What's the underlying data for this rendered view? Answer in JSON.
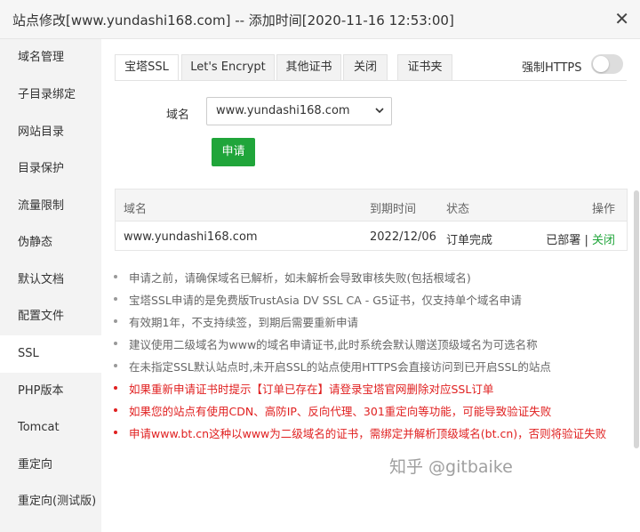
{
  "window": {
    "title": "站点修改[www.yundashi168.com] -- 添加时间[2020-11-16 12:53:00]",
    "close_icon": "close-icon"
  },
  "sidebar": {
    "items": [
      {
        "label": "域名管理"
      },
      {
        "label": "子目录绑定"
      },
      {
        "label": "网站目录"
      },
      {
        "label": "目录保护"
      },
      {
        "label": "流量限制"
      },
      {
        "label": "伪静态"
      },
      {
        "label": "默认文档"
      },
      {
        "label": "配置文件"
      },
      {
        "label": "SSL",
        "active": true
      },
      {
        "label": "PHP版本"
      },
      {
        "label": "Tomcat"
      },
      {
        "label": "重定向"
      },
      {
        "label": "重定向(测试版)"
      }
    ]
  },
  "tabs": [
    {
      "label": "宝塔SSL",
      "active": true
    },
    {
      "label": "Let's Encrypt"
    },
    {
      "label": "其他证书"
    },
    {
      "label": "关闭"
    },
    {
      "label": "证书夹"
    }
  ],
  "force_https": {
    "label": "强制HTTPS",
    "enabled": false
  },
  "form": {
    "domain_label": "域名",
    "domain_value": "www.yundashi168.com",
    "apply_label": "申请"
  },
  "table": {
    "headers": {
      "domain": "域名",
      "expiry": "到期时间",
      "status": "状态",
      "actions": "操作"
    },
    "rows": [
      {
        "domain": "www.yundashi168.com",
        "expiry": "2022/12/06",
        "status": "订单完成",
        "deployed": "已部署",
        "separator": "|",
        "close": "关闭"
      }
    ]
  },
  "notes": [
    {
      "text": "申请之前，请确保域名已解析，如未解析会导致审核失败(包括根域名)",
      "color": "gray"
    },
    {
      "text": "宝塔SSL申请的是免费版TrustAsia DV SSL CA - G5证书，仅支持单个域名申请",
      "color": "gray"
    },
    {
      "text": "有效期1年，不支持续签，到期后需要重新申请",
      "color": "gray"
    },
    {
      "text": "建议使用二级域名为www的域名申请证书,此时系统会默认赠送顶级域名为可选名称",
      "color": "gray"
    },
    {
      "text": "在未指定SSL默认站点时,未开启SSL的站点使用HTTPS会直接访问到已开启SSL的站点",
      "color": "gray"
    },
    {
      "text": "如果重新申请证书时提示【订单已存在】请登录宝塔官网删除对应SSL订单",
      "color": "red"
    },
    {
      "text": "如果您的站点有使用CDN、高防IP、反向代理、301重定向等功能，可能导致验证失败",
      "color": "red"
    },
    {
      "text": "申请www.bt.cn这种以www为二级域名的证书，需绑定并解析顶级域名(bt.cn)，否则将验证失败",
      "color": "red"
    }
  ],
  "watermark": "知乎 @gitbaike",
  "colors": {
    "accent": "#20a53a",
    "warning": "#e02020",
    "sidebar_bg": "#f3f3f3"
  }
}
